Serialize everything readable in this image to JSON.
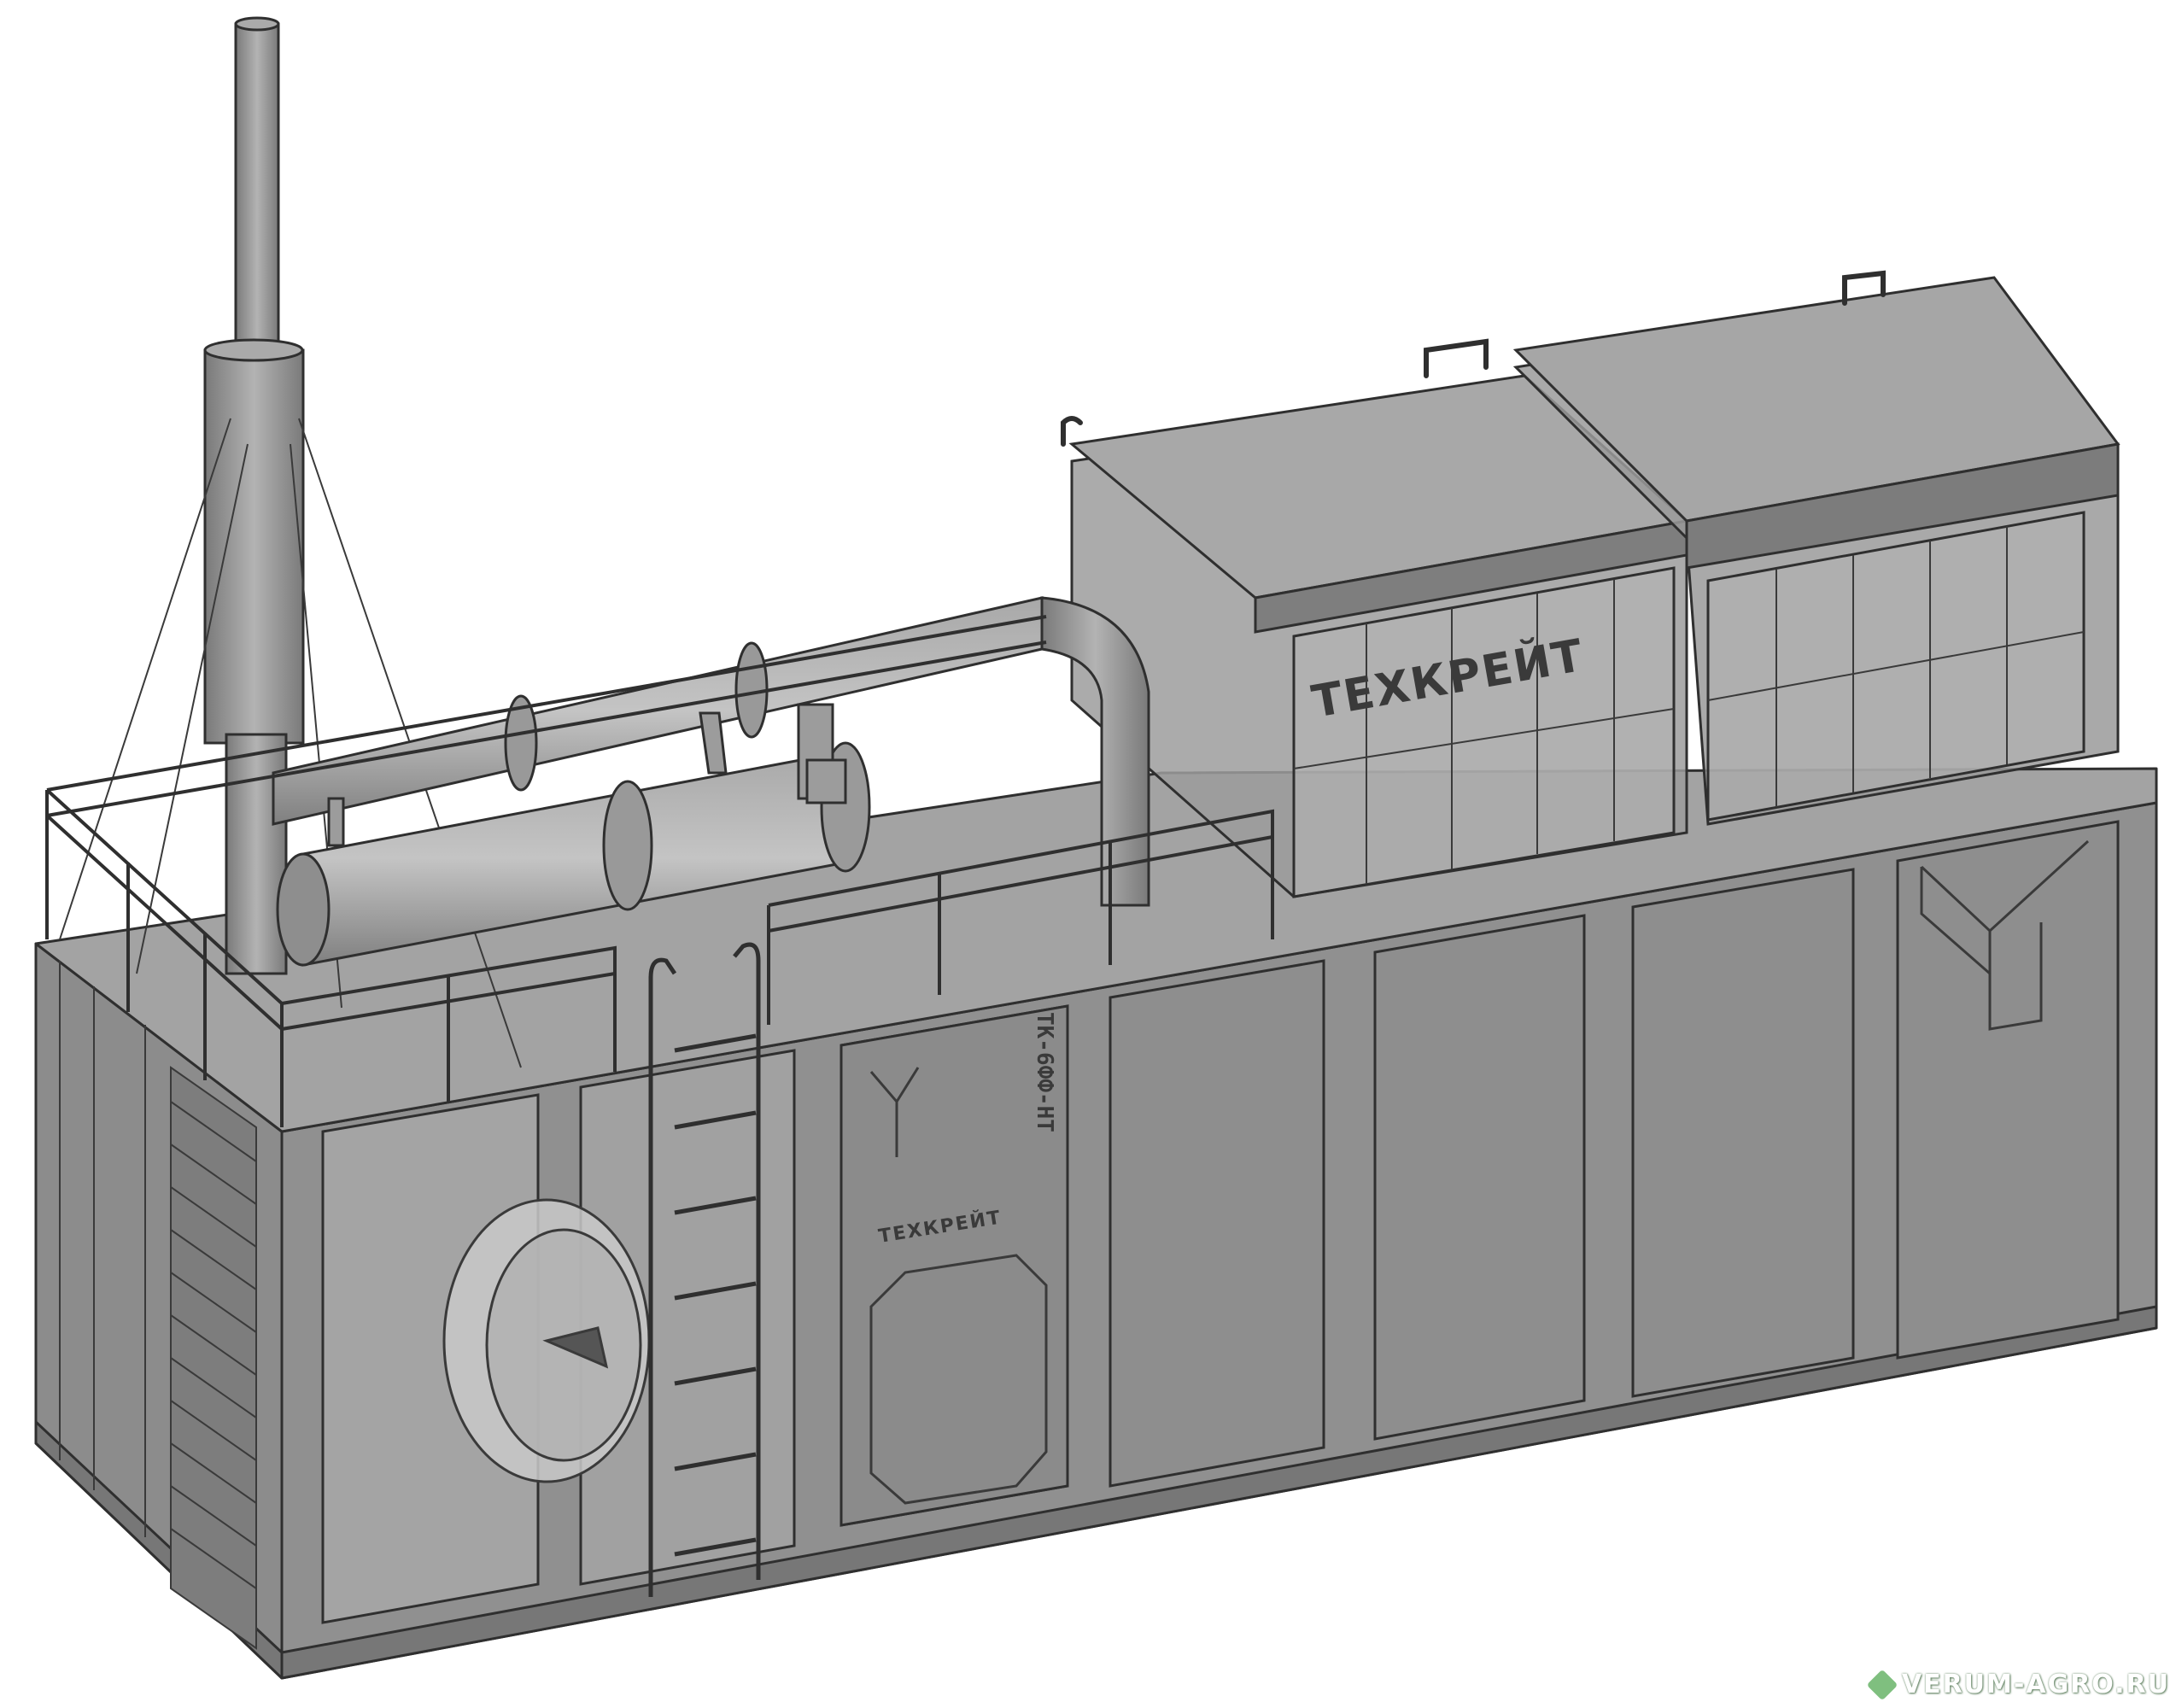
{
  "brand_label_main": "ТЕХКРЕЙТ",
  "brand_label_door": "ТЕХКРЕЙТ",
  "model_label": "ТК-6ФФ-НТ",
  "watermark": "VERUM-AGRO.RU",
  "colors": {
    "container_face": "#8a8a8a",
    "container_dark": "#6e6e6e",
    "glass": "#b4b4b4",
    "outline": "#2f2f2f",
    "watermark_icon": "#7fbf7f"
  }
}
